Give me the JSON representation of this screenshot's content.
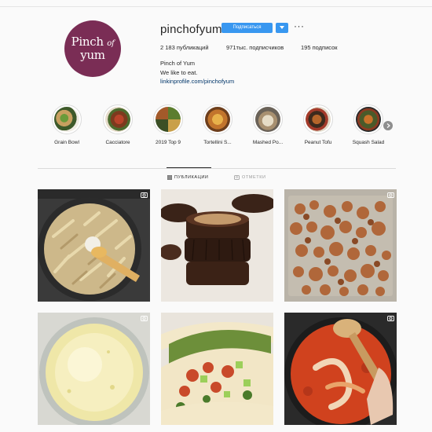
{
  "profile": {
    "username": "pinchofyum",
    "follow_label": "Подписаться",
    "more_label": "···",
    "avatar_logo": {
      "line1": "Pinch",
      "line2": "of",
      "line3": "yum"
    },
    "stats": {
      "posts": "2 183 публикаций",
      "followers": "971тыс. подписчиков",
      "following": "195 подписок"
    },
    "bio": {
      "name": "Pinch of Yum",
      "text": "We like to eat.",
      "link": "linkinprofile.com/pinchofyum"
    }
  },
  "highlights": [
    {
      "label": "Grain Bowl"
    },
    {
      "label": "Cacciatore"
    },
    {
      "label": "2019 Top 9"
    },
    {
      "label": "Tortellini S..."
    },
    {
      "label": "Mashed Po..."
    },
    {
      "label": "Peanut Tofu"
    },
    {
      "label": "Squash Salad"
    }
  ],
  "tabs": {
    "posts": "ПУБЛИКАЦИИ",
    "tagged": "ОТМЕТКИ"
  },
  "colors": {
    "accent": "#3897f0",
    "avatar_bg": "#7a2d55"
  },
  "icons": [
    "grid-icon",
    "tag-icon",
    "camera-icon",
    "chevron-right-icon",
    "chevron-down-icon"
  ]
}
